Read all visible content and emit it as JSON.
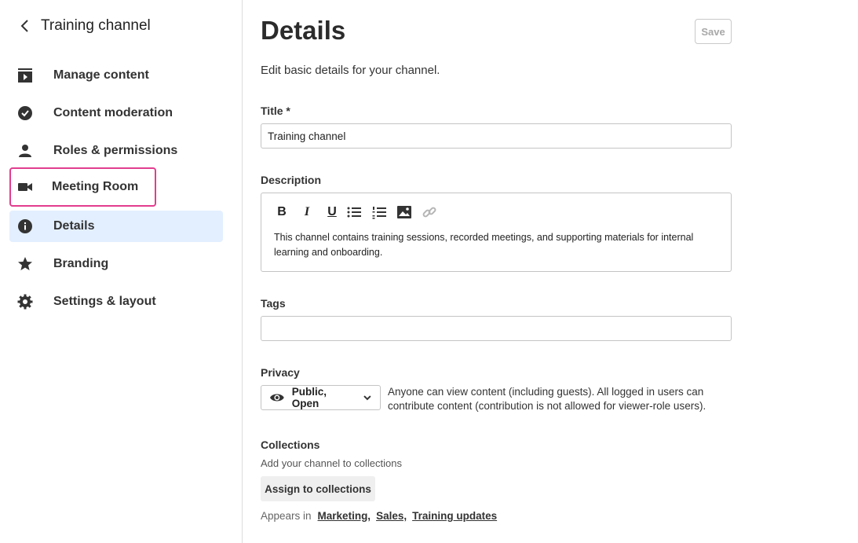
{
  "sidebar": {
    "back_label": "Training channel",
    "items": [
      {
        "label": "Manage content",
        "icon": "play-square-icon"
      },
      {
        "label": "Content moderation",
        "icon": "check-circle-icon"
      },
      {
        "label": "Roles & permissions",
        "icon": "person-icon"
      },
      {
        "label": "Meeting Room",
        "icon": "video-camera-icon"
      },
      {
        "label": "Details",
        "icon": "info-icon"
      },
      {
        "label": "Branding",
        "icon": "star-icon"
      },
      {
        "label": "Settings & layout",
        "icon": "gear-icon"
      }
    ],
    "active": "Details",
    "highlighted": "Meeting Room",
    "highlight_color": "#e23d8e",
    "active_bg": "#e3efff"
  },
  "main": {
    "title": "Details",
    "save_label": "Save",
    "subtitle": "Edit basic details for your channel.",
    "title_field": {
      "label": "Title *",
      "value": "Training channel"
    },
    "description": {
      "label": "Description",
      "toolbar": [
        "B",
        "I",
        "U",
        "bulleted-list-icon",
        "numbered-list-icon",
        "image-icon",
        "link-icon"
      ],
      "text": "This channel contains training sessions, recorded meetings, and supporting materials for internal learning and onboarding."
    },
    "tags": {
      "label": "Tags",
      "value": ""
    },
    "privacy": {
      "label": "Privacy",
      "value": "Public, Open",
      "description": "Anyone can view content (including guests). All logged in users can contribute content (contribution is not allowed for viewer-role users)."
    },
    "collections": {
      "label": "Collections",
      "subtitle": "Add your channel to collections",
      "button": "Assign to collections",
      "appears_prefix": "Appears in",
      "links": [
        "Marketing,",
        "Sales,",
        "Training updates"
      ]
    }
  }
}
